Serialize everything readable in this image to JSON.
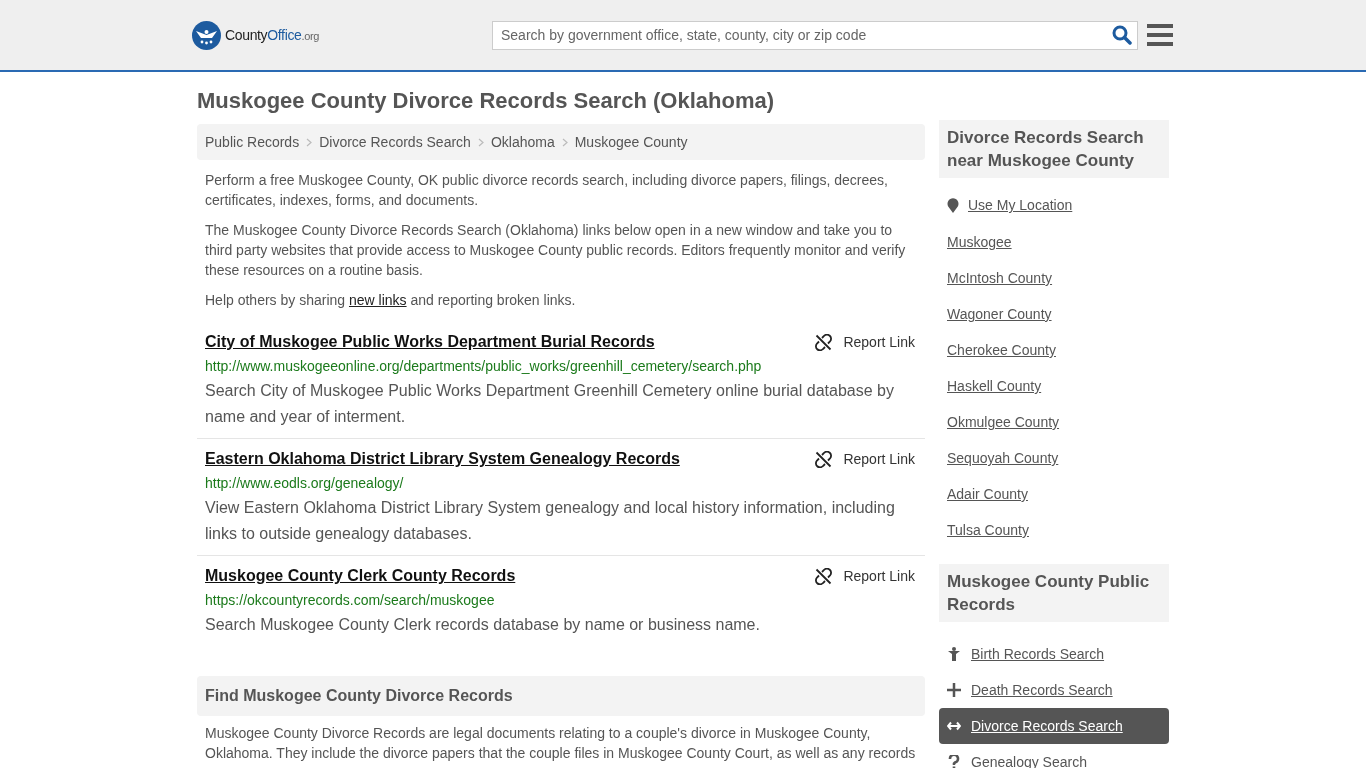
{
  "header": {
    "logo": {
      "parts": [
        {
          "kind": "main",
          "text": "County"
        },
        {
          "kind": "accent",
          "text": "Office"
        },
        {
          "kind": "suffix",
          "text": ".org"
        }
      ]
    },
    "search": {
      "placeholder": "Search by government office, state, county, city or zip code"
    }
  },
  "title": "Muskogee County Divorce Records Search (Oklahoma)",
  "breadcrumb": [
    "Public Records",
    "Divorce Records Search",
    "Oklahoma",
    "Muskogee County"
  ],
  "intro": [
    "Perform a free Muskogee County, OK public divorce records search, including divorce papers, filings, decrees, certificates, indexes, forms, and documents.",
    "The Muskogee County Divorce Records Search (Oklahoma) links below open in a new window and take you to third party websites that provide access to Muskogee County public records. Editors frequently monitor and verify these resources on a routine basis."
  ],
  "share": {
    "before": "Help others by sharing",
    "link": "new links",
    "after": "and reporting broken links."
  },
  "links": [
    {
      "title": "City of Muskogee Public Works Department Burial Records",
      "report": "Report Link",
      "url": "http://www.muskogeeonline.org/departments/public_works/greenhill_cemetery/search.php",
      "description": "Search City of Muskogee Public Works Department Greenhill Cemetery online burial database by name and year of interment."
    },
    {
      "title": "Eastern Oklahoma District Library System Genealogy Records",
      "report": "Report Link",
      "url": "http://www.eodls.org/genealogy/",
      "description": "View Eastern Oklahoma District Library System genealogy and local history information, including links to outside genealogy databases."
    },
    {
      "title": "Muskogee County Clerk County Records",
      "report": "Report Link",
      "url": "https://okcountyrecords.com/search/muskogee",
      "description": "Search Muskogee County Clerk records database by name or business name."
    }
  ],
  "find": {
    "heading": "Find Muskogee County Divorce Records",
    "text": "Muskogee County Divorce Records are legal documents relating to a couple's divorce in Muskogee County, Oklahoma. They include the divorce papers that the couple files in Muskogee County Court, as well as any records"
  },
  "sidebar": {
    "nearby": {
      "heading": "Divorce Records Search near Muskogee County",
      "location": "Use My Location",
      "items": [
        "Muskogee",
        "McIntosh County",
        "Wagoner County",
        "Cherokee County",
        "Haskell County",
        "Okmulgee County",
        "Sequoyah County",
        "Adair County",
        "Tulsa County"
      ]
    },
    "records": {
      "heading": "Muskogee County Public Records",
      "items": [
        {
          "kind": "birth",
          "label": "Birth Records Search",
          "selected": false
        },
        {
          "kind": "death",
          "label": "Death Records Search",
          "selected": false
        },
        {
          "kind": "divorce",
          "label": "Divorce Records Search",
          "selected": true
        },
        {
          "kind": "genealogy",
          "label": "Genealogy Search",
          "selected": false
        }
      ]
    }
  }
}
